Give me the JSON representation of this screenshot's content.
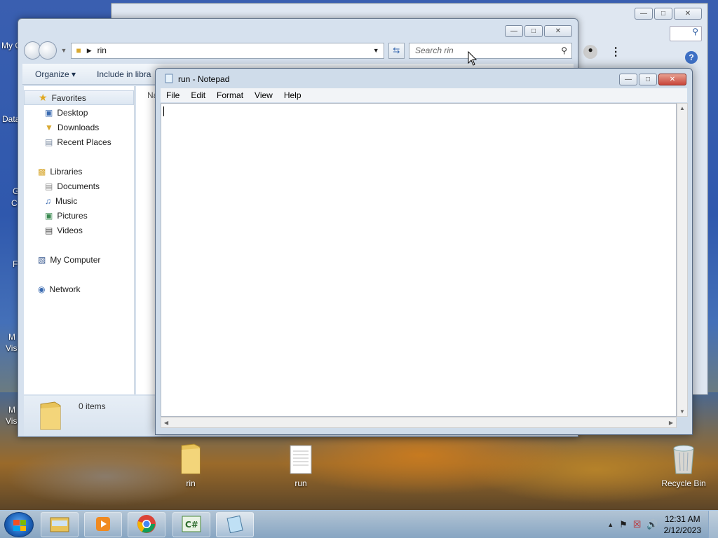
{
  "desktop": {
    "icons": [
      {
        "label": "rin"
      },
      {
        "label": "run"
      },
      {
        "label": "Recycle Bin"
      }
    ],
    "left_partial_labels": [
      "My C",
      "Data",
      "G",
      "C",
      "F",
      "M",
      "Visu",
      "M",
      "Visu"
    ]
  },
  "chrome": {
    "help": "?"
  },
  "explorer": {
    "address_path": "rin",
    "search_placeholder": "Search rin",
    "toolbar": {
      "organize": "Organize",
      "include": "Include in libra"
    },
    "nav": {
      "favorites": "Favorites",
      "desktop": "Desktop",
      "downloads": "Downloads",
      "recent": "Recent Places",
      "libraries": "Libraries",
      "documents": "Documents",
      "music": "Music",
      "pictures": "Pictures",
      "videos": "Videos",
      "computer": "My Computer",
      "network": "Network"
    },
    "column_header_partial": "Na",
    "status": "0 items"
  },
  "notepad": {
    "title": "run - Notepad",
    "menu": [
      "File",
      "Edit",
      "Format",
      "View",
      "Help"
    ],
    "content": ""
  },
  "taskbar": {
    "time": "12:31 AM",
    "date": "2/12/2023"
  }
}
